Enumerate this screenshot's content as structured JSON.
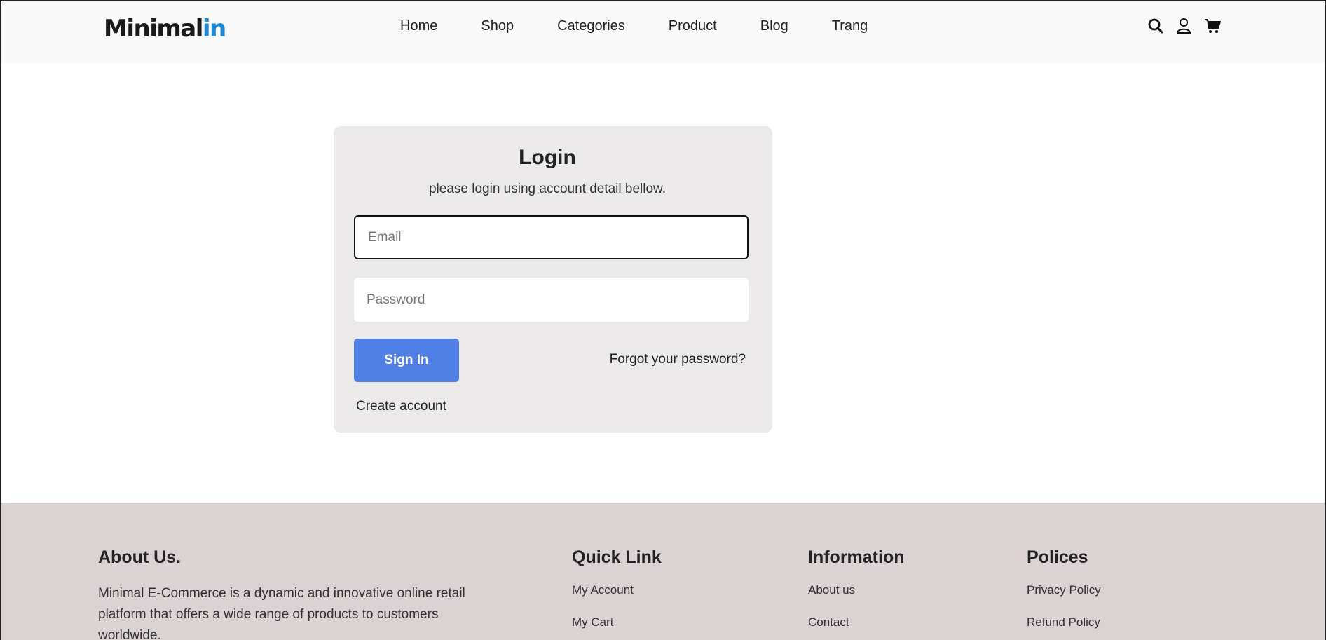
{
  "header": {
    "logo_main": "Minimal",
    "logo_accent": "in",
    "nav": [
      "Home",
      "Shop",
      "Categories",
      "Product",
      "Blog",
      "Trang"
    ],
    "icons": [
      "search-icon",
      "user-icon",
      "cart-icon"
    ]
  },
  "login": {
    "title": "Login",
    "subtitle": "please login using account detail bellow.",
    "email_placeholder": "Email",
    "password_placeholder": "Password",
    "signin_label": "Sign In",
    "forgot_label": "Forgot your password?",
    "create_label": "Create account"
  },
  "footer": {
    "about_title": "About Us.",
    "about_text": "Minimal E-Commerce is a dynamic and innovative online retail platform that offers a wide range of products to customers worldwide.",
    "quick_title": "Quick Link",
    "quick_links": [
      "My Account",
      "My Cart"
    ],
    "info_title": "Information",
    "info_links": [
      "About us",
      "Contact"
    ],
    "policies_title": "Polices",
    "policies_links": [
      "Privacy Policy",
      "Refund Policy"
    ]
  },
  "colors": {
    "accent": "#1e88d6",
    "button": "#5080e6",
    "card_bg": "#ebe9ea",
    "footer_bg": "#dbd2d3"
  }
}
